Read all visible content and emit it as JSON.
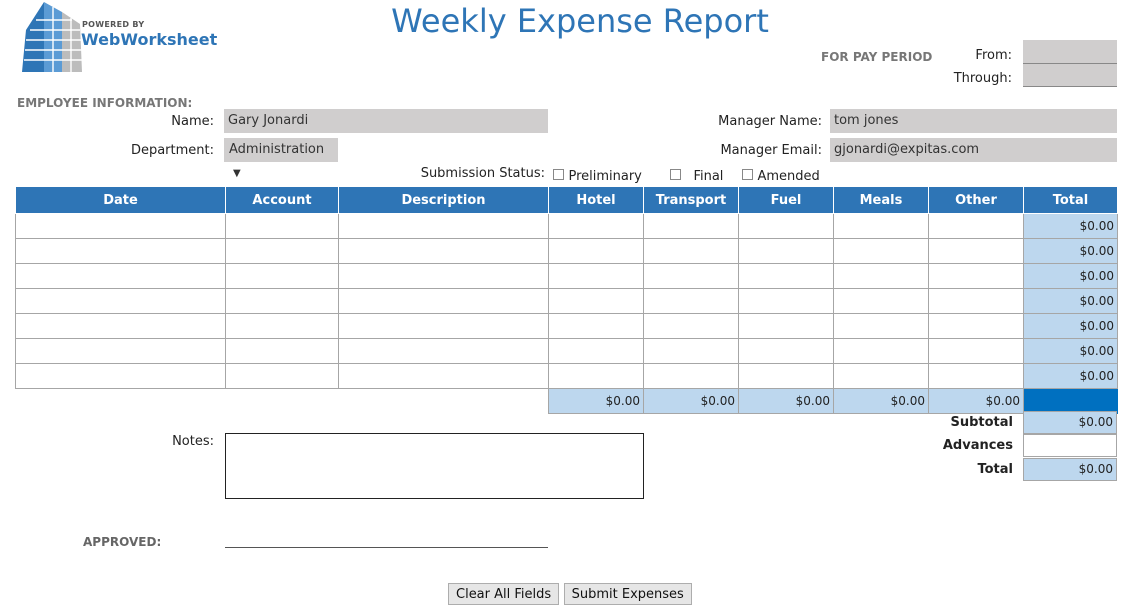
{
  "brand": {
    "powered_by": "POWERED BY",
    "name": "WebWorksheet"
  },
  "title": "Weekly Expense Report",
  "pay_period": {
    "heading": "FOR PAY PERIOD",
    "from_label": "From:",
    "through_label": "Through:",
    "from_value": "",
    "through_value": ""
  },
  "employee": {
    "section": "EMPLOYEE INFORMATION:",
    "name_label": "Name:",
    "name_value": "Gary Jonardi",
    "department_label": "Department:",
    "department_value": "Administration",
    "manager_name_label": "Manager Name:",
    "manager_name_value": "tom jones",
    "manager_email_label": "Manager Email:",
    "manager_email_value": "gjonardi@expitas.com"
  },
  "submission": {
    "label": "Submission Status:",
    "options": [
      "Preliminary",
      "Final",
      "Amended"
    ]
  },
  "table": {
    "headers": [
      "Date",
      "Account",
      "Description",
      "Hotel",
      "Transport",
      "Fuel",
      "Meals",
      "Other",
      "Total"
    ],
    "row_totals": [
      "$0.00",
      "$0.00",
      "$0.00",
      "$0.00",
      "$0.00",
      "$0.00",
      "$0.00"
    ],
    "column_totals": [
      "$0.00",
      "$0.00",
      "$0.00",
      "$0.00",
      "$0.00"
    ]
  },
  "summary": {
    "subtotal_label": "Subtotal",
    "subtotal_value": "$0.00",
    "advances_label": "Advances",
    "advances_value": "",
    "total_label": "Total",
    "total_value": "$0.00"
  },
  "notes_label": "Notes:",
  "approved_label": "APPROVED:",
  "buttons": {
    "clear": "Clear All Fields",
    "submit": "Submit Expenses"
  },
  "colors": {
    "accent": "#2e75b6",
    "light_blue": "#bdd7ee",
    "gray_field": "#d0cece",
    "dark_blue": "#0070c0"
  }
}
